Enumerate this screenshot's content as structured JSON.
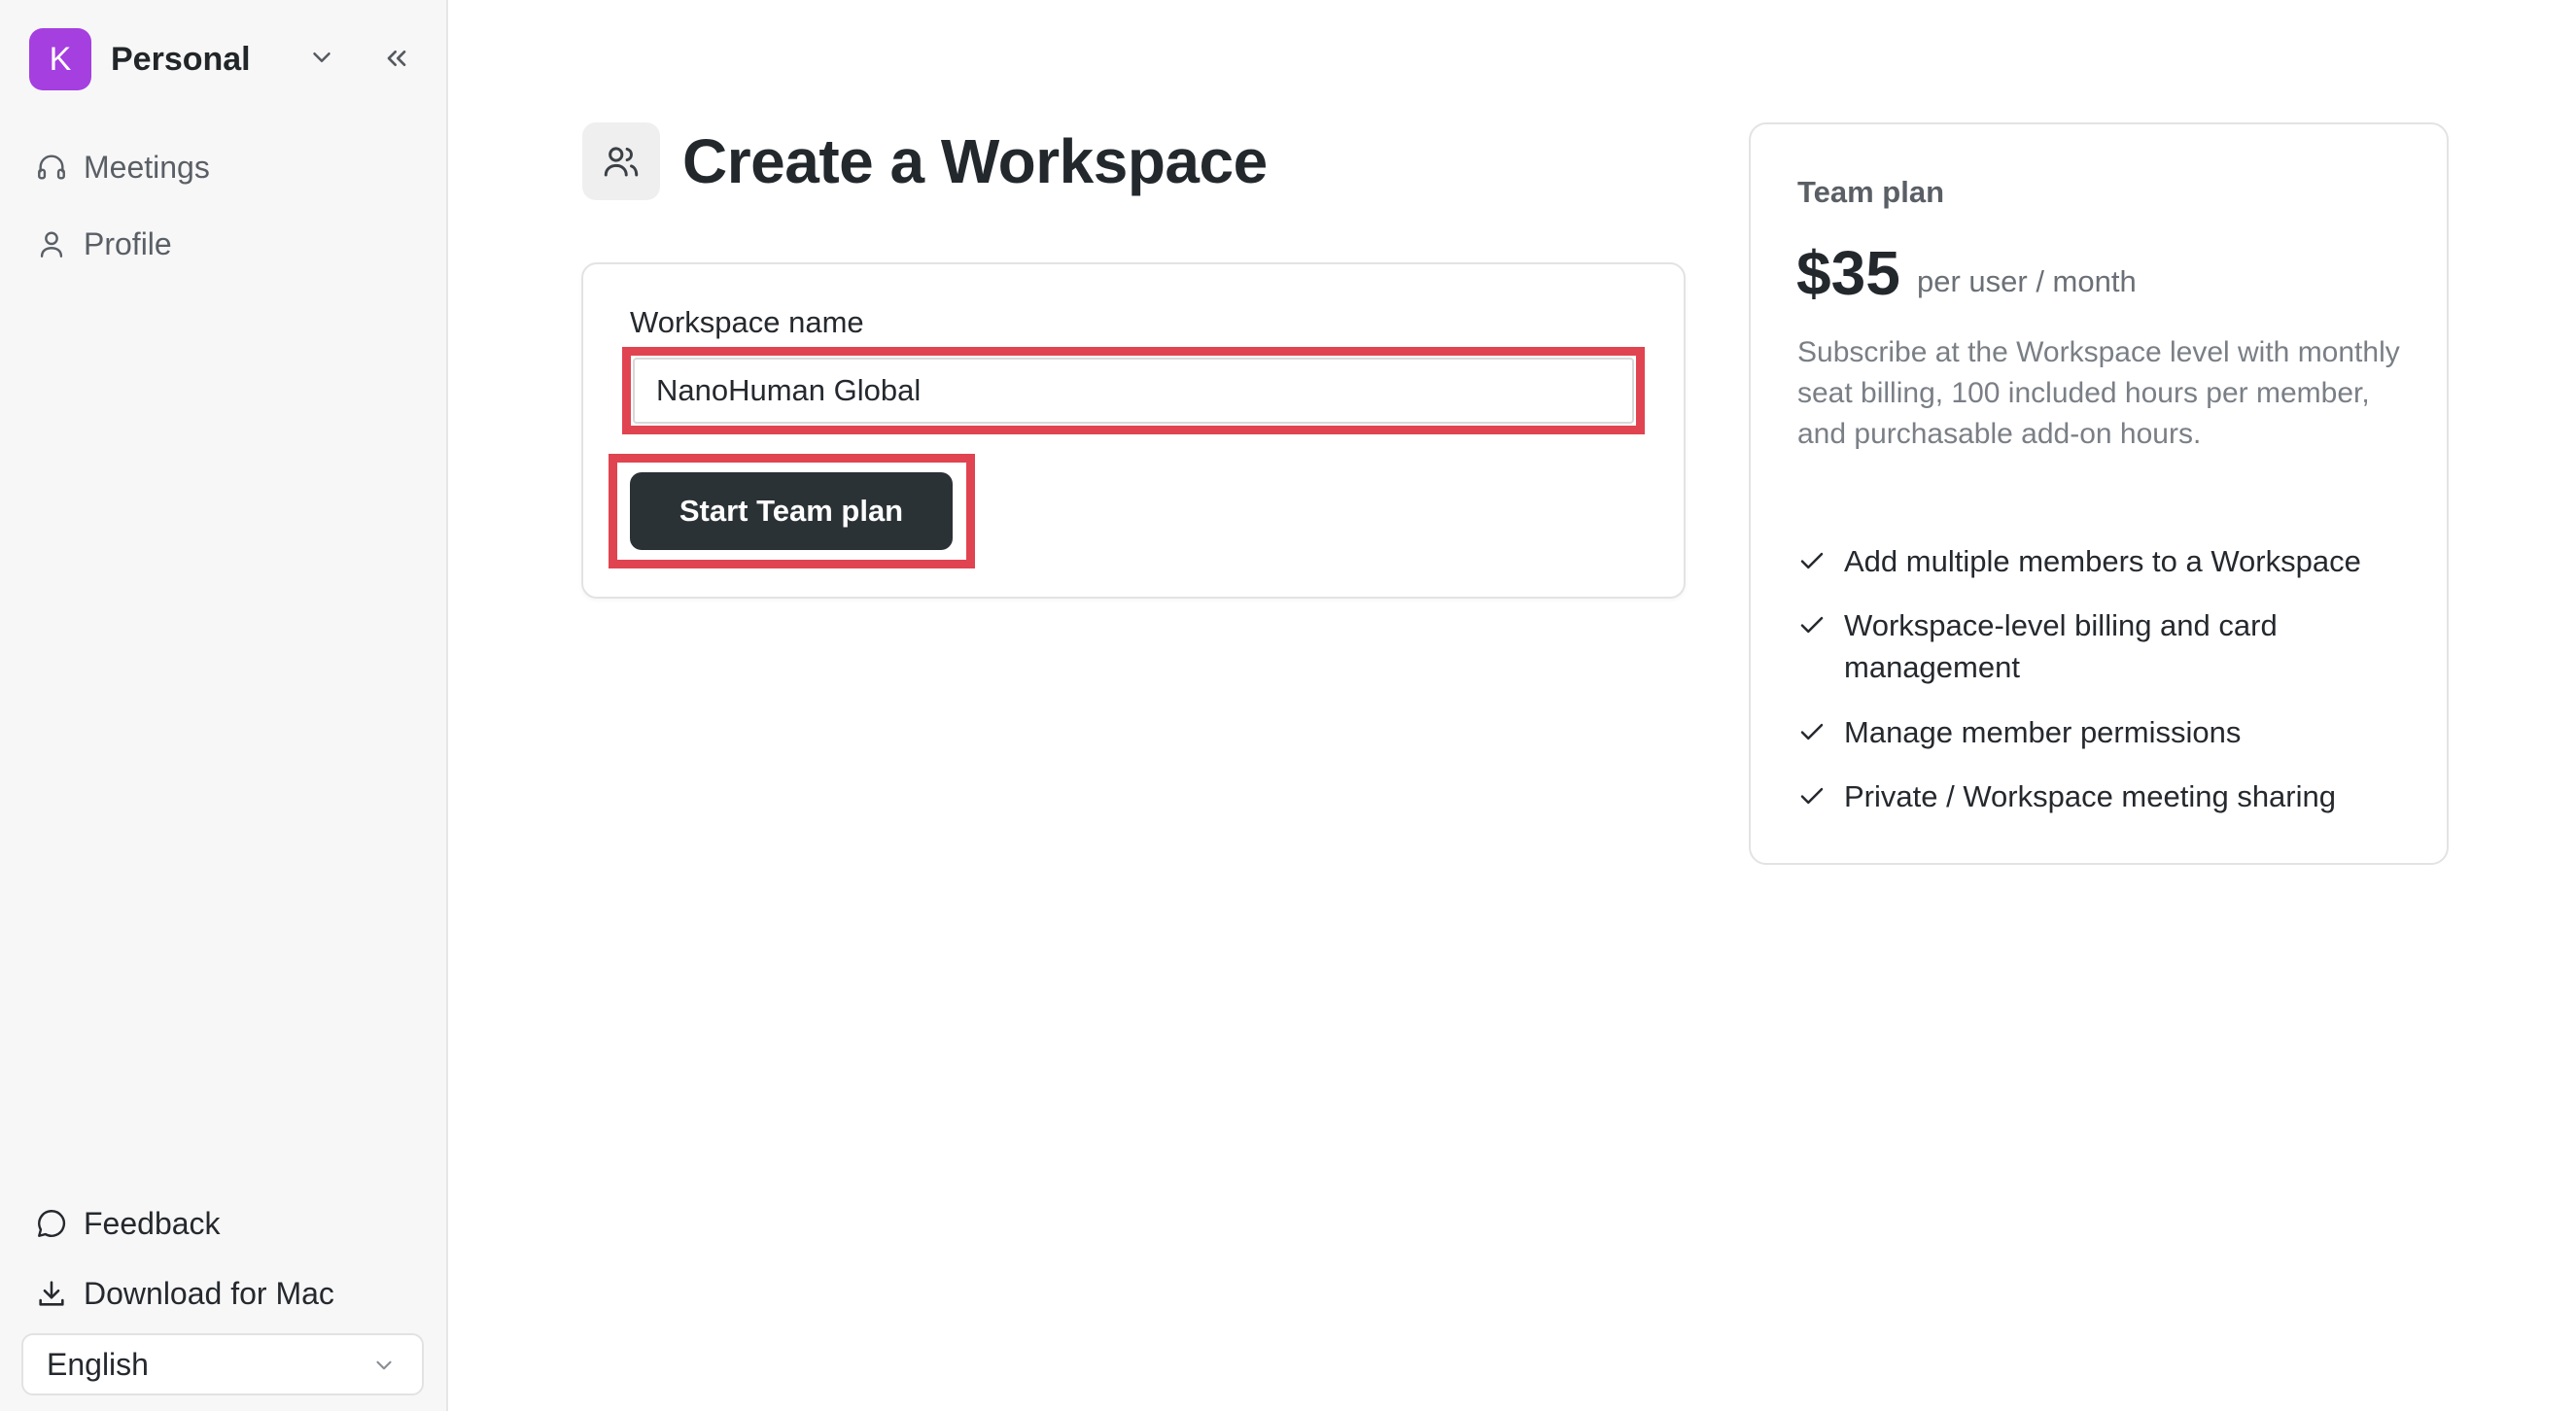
{
  "workspace_switcher": {
    "avatar_letter": "K",
    "name": "Personal",
    "avatar_color": "#a53fe0"
  },
  "sidebar": {
    "nav": [
      {
        "label": "Meetings",
        "icon": "headphones-icon"
      },
      {
        "label": "Profile",
        "icon": "user-icon"
      }
    ],
    "bottom": [
      {
        "label": "Feedback",
        "icon": "chat-bubble-icon"
      },
      {
        "label": "Download for Mac",
        "icon": "download-icon"
      }
    ],
    "language": {
      "value": "English"
    }
  },
  "main": {
    "title": "Create a Workspace",
    "form": {
      "field_label": "Workspace name",
      "field_value": "NanoHuman Global",
      "submit_label": "Start Team plan"
    }
  },
  "plan": {
    "name": "Team plan",
    "price": "$35",
    "period": "per user / month",
    "description": "Subscribe at the Workspace level with monthly seat billing, 100 included hours per member, and purchasable add-on hours.",
    "features": [
      "Add multiple members to a Workspace",
      "Workspace-level billing and card management",
      "Manage member permissions",
      "Private / Workspace meeting sharing"
    ]
  },
  "colors": {
    "highlight": "#e04450",
    "button": "#2b3236",
    "sidebar_bg": "#f7f7f7"
  }
}
